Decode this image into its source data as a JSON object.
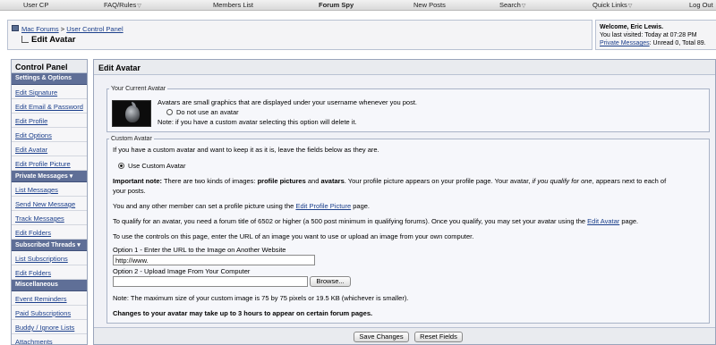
{
  "topnav": {
    "items": [
      "User CP",
      "FAQ/Rules",
      "Members List",
      "Forum Spy",
      "New Posts",
      "Search",
      "Quick Links",
      "Log Out"
    ]
  },
  "breadcrumb": {
    "forum": "Mac Forums",
    "section": "User Control Panel",
    "title": "Edit Avatar"
  },
  "welcome": {
    "title": "Welcome, Eric Lewis.",
    "last_visited": "You last visited: Today at 07:28 PM",
    "pm_label": "Private Messages",
    "pm_counts": ": Unread 0, Total 89."
  },
  "sidebar": {
    "title": "Control Panel",
    "sections": [
      {
        "label": "Settings & Options",
        "items": [
          "Edit Signature",
          "Edit Email & Password",
          "Edit Profile",
          "Edit Options",
          "Edit Avatar",
          "Edit Profile Picture"
        ]
      },
      {
        "label": "Private Messages ▾",
        "items": [
          "List Messages",
          "Send New Message",
          "Track Messages",
          "Edit Folders"
        ]
      },
      {
        "label": "Subscribed Threads ▾",
        "items": [
          "List Subscriptions",
          "Edit Folders"
        ]
      },
      {
        "label": "Miscellaneous",
        "items": [
          "Event Reminders",
          "Paid Subscriptions",
          "Buddy / Ignore Lists",
          "Attachments"
        ]
      }
    ]
  },
  "main": {
    "title": "Edit Avatar",
    "current": {
      "legend": "Your Current Avatar",
      "desc": "Avatars are small graphics that are displayed under your username whenever you post.",
      "no_avatar_label": "Do not use an avatar",
      "note": "Note: if you have a custom avatar selecting this option will delete it."
    },
    "custom": {
      "legend": "Custom Avatar",
      "keep_text": "If you have a custom avatar and want to keep it as it is, leave the fields below as they are.",
      "use_custom_label": "Use Custom Avatar",
      "important_label": "Important note:",
      "important_a": " There are two kinds of images: ",
      "profile_pictures": "profile pictures",
      "and": " and ",
      "avatars": "avatars",
      "important_b": ". Your profile picture appears on your profile page. Your avatar, ",
      "qualify_italic": "if you qualify for one",
      "important_c": ", appears next to each of",
      "important_d": "your posts.",
      "any_member_a": "You and any other member can set a profile picture using the ",
      "edit_profile_picture_link": "Edit Profile Picture",
      "any_member_b": " page.",
      "qualify_a": "To qualify for an avatar, you need a forum title of 6502 or higher (a 500 post minimum in qualifying forums). Once you qualify, you may set your avatar using the ",
      "edit_avatar_link": "Edit Avatar",
      "qualify_b": " page.",
      "controls_text": "To use the controls on this page, enter the URL of an image you want to use or upload an image from your own computer.",
      "option1_label": "Option 1 - Enter the URL to the Image on Another Website",
      "url_value": "http://www.",
      "option2_label": "Option 2 - Upload Image From Your Computer",
      "browse_label": "Browse...",
      "max_note": "Note: The maximum size of your custom image is 75 by 75 pixels or 19.5 KB (whichever is smaller).",
      "changes_note": "Changes to your avatar may take up to 3 hours to appear on certain forum pages."
    },
    "save_label": "Save Changes",
    "reset_label": "Reset Fields"
  }
}
